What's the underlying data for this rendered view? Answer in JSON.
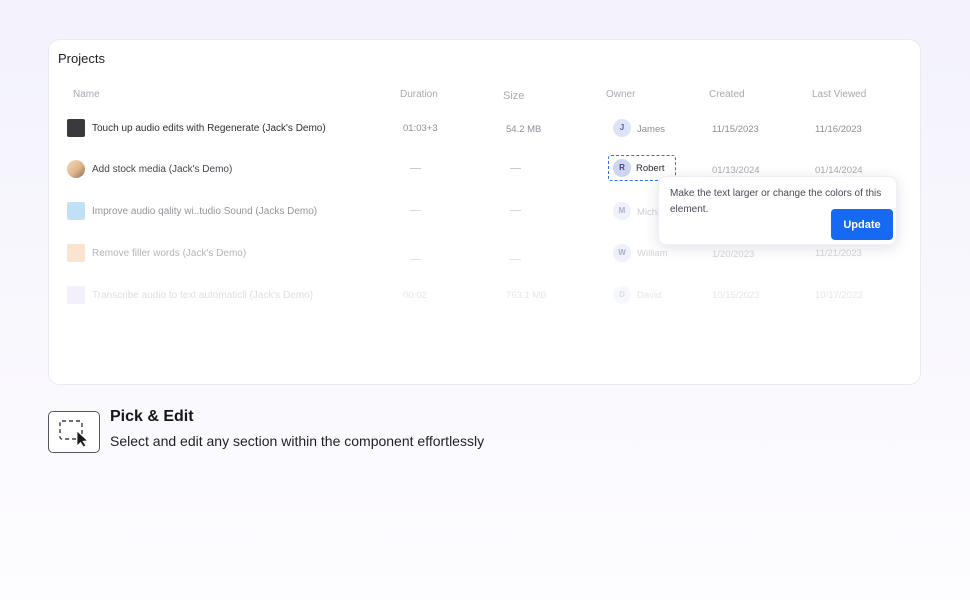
{
  "card": {
    "title": "Projects"
  },
  "columns": {
    "name": "Name",
    "duration": "Duration",
    "size": "Size",
    "owner": "Owner",
    "created": "Created",
    "last_viewed": "Last Viewed"
  },
  "rows": [
    {
      "name": "Touch up audio edits with Regenerate (Jack's Demo)",
      "duration": "01:03+3",
      "size": "54.2 MB",
      "owner_initial": "J",
      "owner": "James",
      "created": "11/15/2023",
      "last_viewed": "11/16/2023",
      "thumb_color": "#3a3a3e"
    },
    {
      "name": "Add stock media (Jack's Demo)",
      "duration": "",
      "size": "",
      "owner_initial": "R",
      "owner": "Robert",
      "created": "01/13/2024",
      "last_viewed": "01/14/2024",
      "thumb_color": "#e9c9a4"
    },
    {
      "name": "Improve audio qality wi..tudio Sound (Jacks Demo)",
      "duration": "",
      "size": "",
      "owner_initial": "M",
      "owner": "Michael",
      "created": "",
      "last_viewed": "",
      "thumb_color": "#9fd0f0"
    },
    {
      "name": "Remove filler words (Jack's Demo)",
      "duration": "",
      "size": "",
      "owner_initial": "W",
      "owner": "William",
      "created": "1/20/2023",
      "last_viewed": "11/21/2023",
      "thumb_color": "#f6c7a2"
    },
    {
      "name": "Transcribe audio to text automaticll (Jack's Demo)",
      "duration": "00:02",
      "size": "763.1 MB",
      "owner_initial": "D",
      "owner": "David",
      "created": "10/15/2023",
      "last_viewed": "10/17/2023",
      "thumb_color": "#c9b8ec"
    }
  ],
  "tooltip": {
    "text": "Make the text larger or change the colors of this element.",
    "button": "Update"
  },
  "feature": {
    "title": "Pick & Edit",
    "description": "Select and edit any section within the component effortlessly",
    "icon": "pick-select-cursor-icon"
  },
  "colors": {
    "accent": "#1669f2",
    "selection_outline": "#2f6df5"
  }
}
